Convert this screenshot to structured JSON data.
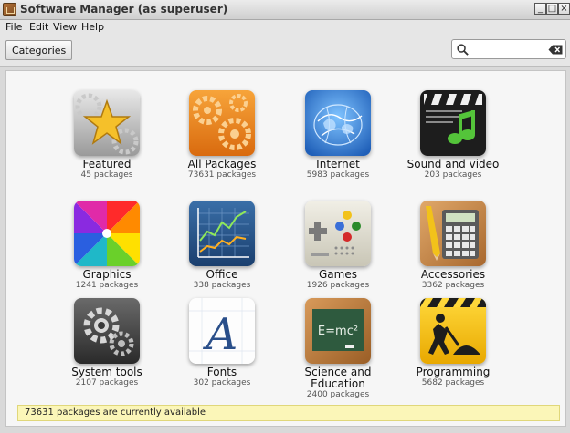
{
  "window": {
    "title": "Software Manager (as superuser)",
    "minimize_label": "_",
    "maximize_label": "□",
    "close_label": "×"
  },
  "menu": [
    {
      "label": "File"
    },
    {
      "label": "Edit"
    },
    {
      "label": "View"
    },
    {
      "label": "Help"
    }
  ],
  "toolbar": {
    "categories_label": "Categories",
    "search_value": "",
    "search_placeholder": ""
  },
  "categories": [
    {
      "label": "Featured",
      "count": "45 packages",
      "icon": "star-icon"
    },
    {
      "label": "All Packages",
      "count": "73631 packages",
      "icon": "gears-icon"
    },
    {
      "label": "Internet",
      "count": "5983 packages",
      "icon": "globe-icon"
    },
    {
      "label": "Sound and video",
      "count": "203 packages",
      "icon": "music-clapper-icon"
    },
    {
      "label": "Graphics",
      "count": "1241 packages",
      "icon": "color-wheel-icon"
    },
    {
      "label": "Office",
      "count": "338 packages",
      "icon": "line-chart-icon"
    },
    {
      "label": "Games",
      "count": "1926 packages",
      "icon": "gamepad-icon"
    },
    {
      "label": "Accessories",
      "count": "3362 packages",
      "icon": "calculator-icon"
    },
    {
      "label": "System tools",
      "count": "2107 packages",
      "icon": "system-gear-icon"
    },
    {
      "label": "Fonts",
      "count": "302 packages",
      "icon": "font-a-icon"
    },
    {
      "label": "Science and Education",
      "count": "2400 packages",
      "icon": "chalkboard-icon"
    },
    {
      "label": "Programming",
      "count": "5682 packages",
      "icon": "construction-icon"
    }
  ],
  "status": {
    "text": "73631 packages are currently available"
  },
  "colors": {
    "status_bg": "#fbf6b8",
    "featured_orange": "#f5a623",
    "internet_blue": "#2f7ed8",
    "programming_yellow": "#f2c300"
  }
}
